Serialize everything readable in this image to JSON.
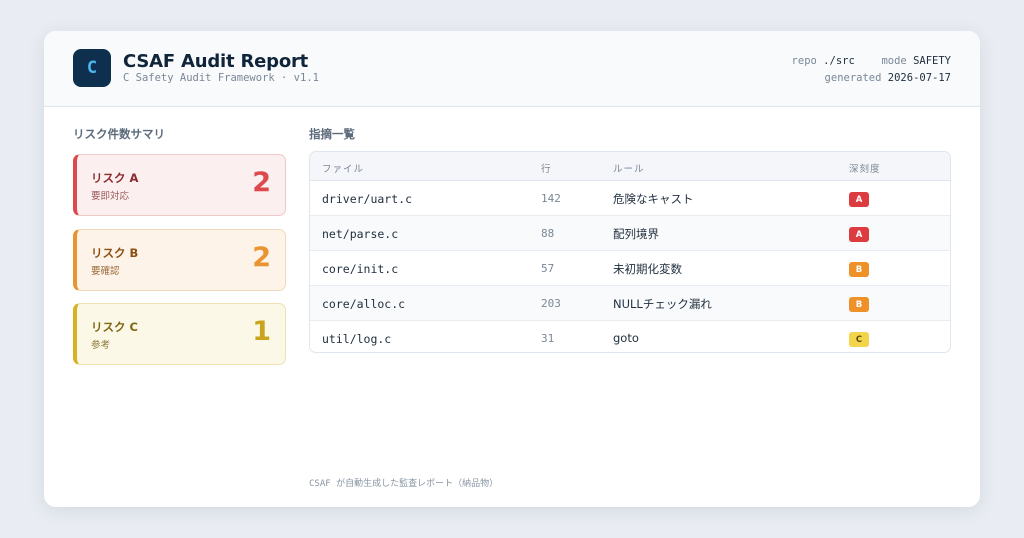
{
  "header": {
    "logo_letter": "C",
    "title": "CSAF Audit Report",
    "subtitle": "C Safety Audit Framework · v1.1",
    "repo_label": "repo",
    "repo_value": "./src",
    "mode_label": "mode",
    "mode_value": "SAFETY",
    "generated_label": "generated",
    "generated_value": "2026-07-17"
  },
  "summary": {
    "title": "リスク件数サマリ",
    "items": [
      {
        "name": "リスク A",
        "desc": "要即対応",
        "count": "2"
      },
      {
        "name": "リスク B",
        "desc": "要確認",
        "count": "2"
      },
      {
        "name": "リスク C",
        "desc": "参考",
        "count": "1"
      }
    ]
  },
  "findings": {
    "title": "指摘一覧",
    "columns": [
      "ファイル",
      "行",
      "ルール",
      "深刻度"
    ],
    "rows": [
      {
        "file": "driver/uart.c",
        "line": "142",
        "rule": "危険なキャスト",
        "severity": "A"
      },
      {
        "file": "net/parse.c",
        "line": "88",
        "rule": "配列境界",
        "severity": "A"
      },
      {
        "file": "core/init.c",
        "line": "57",
        "rule": "未初期化変数",
        "severity": "B"
      },
      {
        "file": "core/alloc.c",
        "line": "203",
        "rule": "NULLチェック漏れ",
        "severity": "B"
      },
      {
        "file": "util/log.c",
        "line": "31",
        "rule": "goto",
        "severity": "C"
      }
    ]
  },
  "footer": "CSAF が自動生成した監査レポート（納品物）",
  "colors": {
    "risk_a": "#dc4a4e",
    "risk_b": "#ea9331",
    "risk_c": "#d6b325",
    "logo_bg": "#0f2f4e"
  }
}
